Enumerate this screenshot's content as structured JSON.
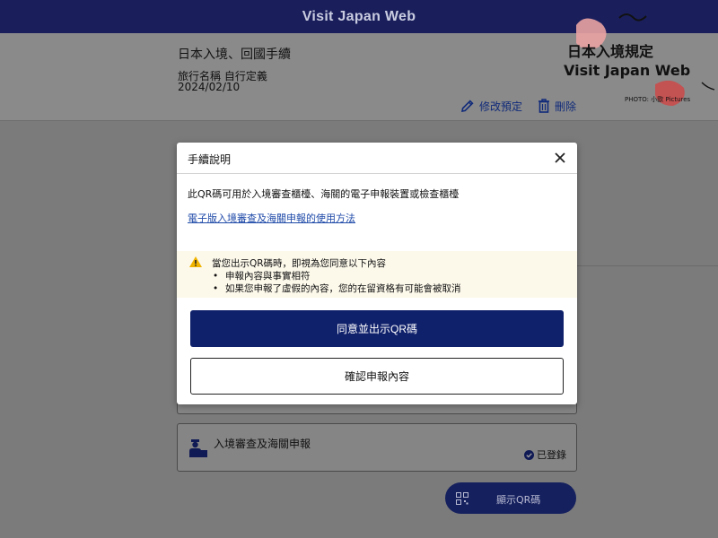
{
  "header": {
    "title": "Visit Japan Web"
  },
  "trip": {
    "title": "日本入境、回國手續",
    "name_line": "旅行名稱 自行定義",
    "date": "2024/02/10",
    "edit_label": "修改預定",
    "delete_label": "刪除"
  },
  "background": {
    "immigration_card": {
      "label": "入境審查及海關申報",
      "status": "已登錄"
    },
    "qr_button_label": "顯示QR碼"
  },
  "modal": {
    "title": "手續說明",
    "description": "此QR碼可用於入境審查櫃檯、海關的電子申報裝置或檢查櫃檯",
    "link": "電子版入境審查及海關申報的使用方法",
    "notice_lead": "當您出示QR碼時，即視為您同意以下內容",
    "notice_items": [
      "申報內容與事實相符",
      "如果您申報了虛假的內容，您的在留資格有可能會被取消"
    ],
    "primary_button": "同意並出示QR碼",
    "secondary_button": "確認申報內容"
  },
  "watermark": {
    "line1": "日本入境規定",
    "line2": "Visit Japan Web",
    "credit": "PHOTO: 小歐 Pictures"
  },
  "colors": {
    "navy": "#10216b",
    "header": "#1a1f5c",
    "link": "#1f4aa8",
    "notice_bg": "#fcf8ea",
    "overlay": "#7b7b7b"
  }
}
